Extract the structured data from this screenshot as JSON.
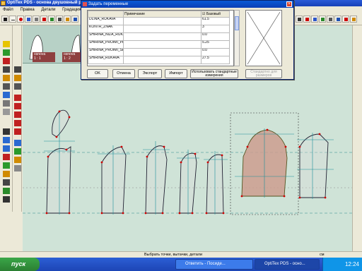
{
  "window": {
    "title": "OptiTex PDS - основа двушовный рукав"
  },
  "menubar": {
    "items": [
      "Файл",
      "Правка",
      "Детали",
      "Градация"
    ]
  },
  "strip": {
    "labels": [
      "osnova",
      "osnova"
    ],
    "sub": [
      "1 : 1",
      "1 : 2"
    ]
  },
  "dialog": {
    "title": "Задать переменные",
    "columns": {
      "primechanie": "Примечание",
      "bazovy": "Базовый"
    },
    "rows": [
      {
        "name": "DLINA_RUKAVA",
        "value": "61.5"
      },
      {
        "name": "KONTR_ZNAK",
        "value": "3"
      },
      {
        "name": "SHIRINA_NIZA_RUKAVA",
        "value": "0.0"
      },
      {
        "name": "SHIRINA_PROIMI_PEREDA",
        "value": "5.25"
      },
      {
        "name": "SHIRINA_PROIMI_SPINI",
        "value": "0.0"
      },
      {
        "name": "SHIRINA_RUKAVA",
        "value": "27.5"
      }
    ],
    "buttons": {
      "ok": "OK",
      "cancel": "Отмена",
      "export": "Экспорт",
      "import": "Импорт",
      "standard": "Использовать стандартные измерения",
      "standard_sizes": "Стандартно для размеров"
    }
  },
  "status": {
    "hint": "Выбрать точки, вытачки, детали",
    "units": "см"
  },
  "taskbar": {
    "start": "пуск",
    "tasks": [
      "Ответить - Посиде...",
      "OptiTex PDS - осно..."
    ],
    "time": "12:24"
  },
  "colors": {
    "selected_piece": "#cd9d8f",
    "canvas": "#cfe3d7",
    "points": "#cc0000",
    "dims": "#1a8e9a"
  }
}
